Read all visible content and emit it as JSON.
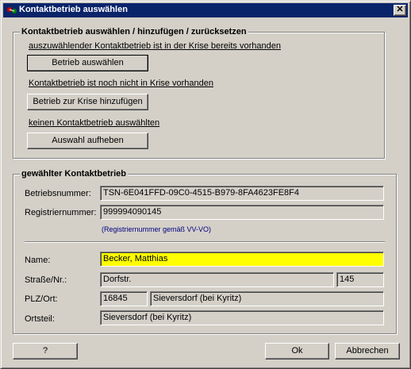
{
  "window": {
    "title": "Kontaktbetrieb auswählen",
    "close_label": "✕"
  },
  "group_select": {
    "legend": "Kontaktbetrieb auswählen / hinzufügen / zurücksetzen",
    "existing_text": "auszuwählender Kontaktbetrieb ist in der Krise bereits vorhanden",
    "select_button": "Betrieb auswählen",
    "not_existing_text": "Kontaktbetrieb ist noch nicht in Krise vorhanden",
    "add_button": "Betrieb zur Krise hinzufügen",
    "none_text": "keinen Kontaktbetrieb auswählten",
    "clear_button": "Auswahl aufheben"
  },
  "group_selected": {
    "legend": "gewählter Kontaktbetrieb",
    "betriebsnummer_label": "Betriebsnummer:",
    "betriebsnummer_value": "TSN-6E041FFD-09C0-4515-B979-8FA4623FE8F4",
    "registriernummer_label": "Registriernummer:",
    "registriernummer_value": "999994090145",
    "registriernummer_hint": "(Registriernummer gemäß VV-VO)",
    "name_label": "Name:",
    "name_value": "Becker, Matthias",
    "strasse_label": "Straße/Nr.:",
    "strasse_value": "Dorfstr.",
    "hausnummer_value": "145",
    "plz_ort_label": "PLZ/Ort:",
    "plz_value": "16845",
    "ort_value": "Sieversdorf (bei Kyritz)",
    "ortsteil_label": "Ortsteil:",
    "ortsteil_value": "Sieversdorf (bei Kyritz)"
  },
  "footer": {
    "help_button": "?",
    "ok_button": "Ok",
    "cancel_button": "Abbrechen"
  },
  "colors": {
    "titlebar": "#0a246a",
    "face": "#d4d0c8",
    "highlight_field": "#ffff00",
    "hint_text": "#000080"
  }
}
